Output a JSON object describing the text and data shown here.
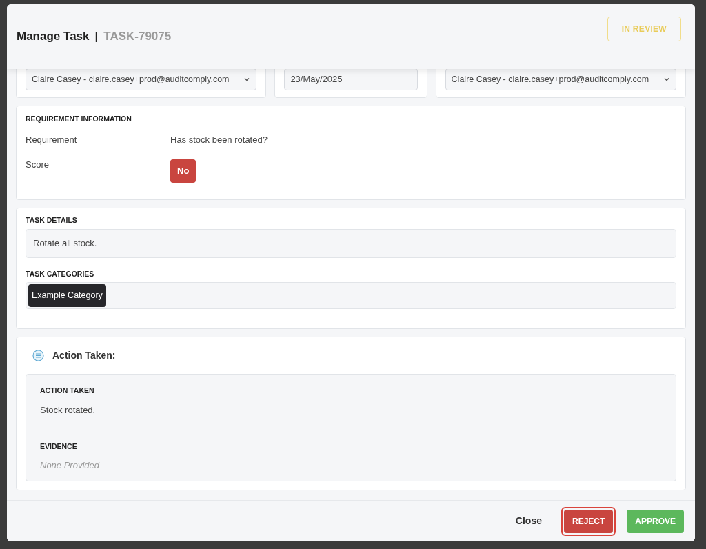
{
  "modal": {
    "title": "Manage Task",
    "separator": "|",
    "task_id": "TASK-79075",
    "status": "IN REVIEW"
  },
  "top_fields": [
    {
      "kind": "select",
      "value": "Claire Casey - claire.casey+prod@auditcomply.com"
    },
    {
      "kind": "date",
      "value": "23/May/2025"
    },
    {
      "kind": "select",
      "value": "Claire Casey - claire.casey+prod@auditcomply.com"
    }
  ],
  "requirement_information": {
    "heading": "REQUIREMENT INFORMATION",
    "rows": [
      {
        "kind": "text",
        "label": "Requirement",
        "value": "Has stock been rotated?"
      },
      {
        "kind": "score",
        "label": "Score",
        "value": "No"
      }
    ]
  },
  "task_details": {
    "heading": "TASK DETAILS",
    "value": "Rotate all stock."
  },
  "task_categories": {
    "heading": "TASK CATEGORIES",
    "tags": [
      "Example Category"
    ]
  },
  "action_taken": {
    "title": "Action Taken:",
    "sections": [
      {
        "kind": "text",
        "heading": "ACTION TAKEN",
        "value": "Stock rotated."
      },
      {
        "kind": "empty",
        "heading": "EVIDENCE",
        "value": "None Provided"
      }
    ]
  },
  "footer": {
    "buttons": [
      {
        "kind": "link",
        "label": "Close",
        "focused": false
      },
      {
        "kind": "danger",
        "label": "REJECT",
        "focused": true
      },
      {
        "kind": "success",
        "label": "APPROVE",
        "focused": false
      }
    ]
  }
}
